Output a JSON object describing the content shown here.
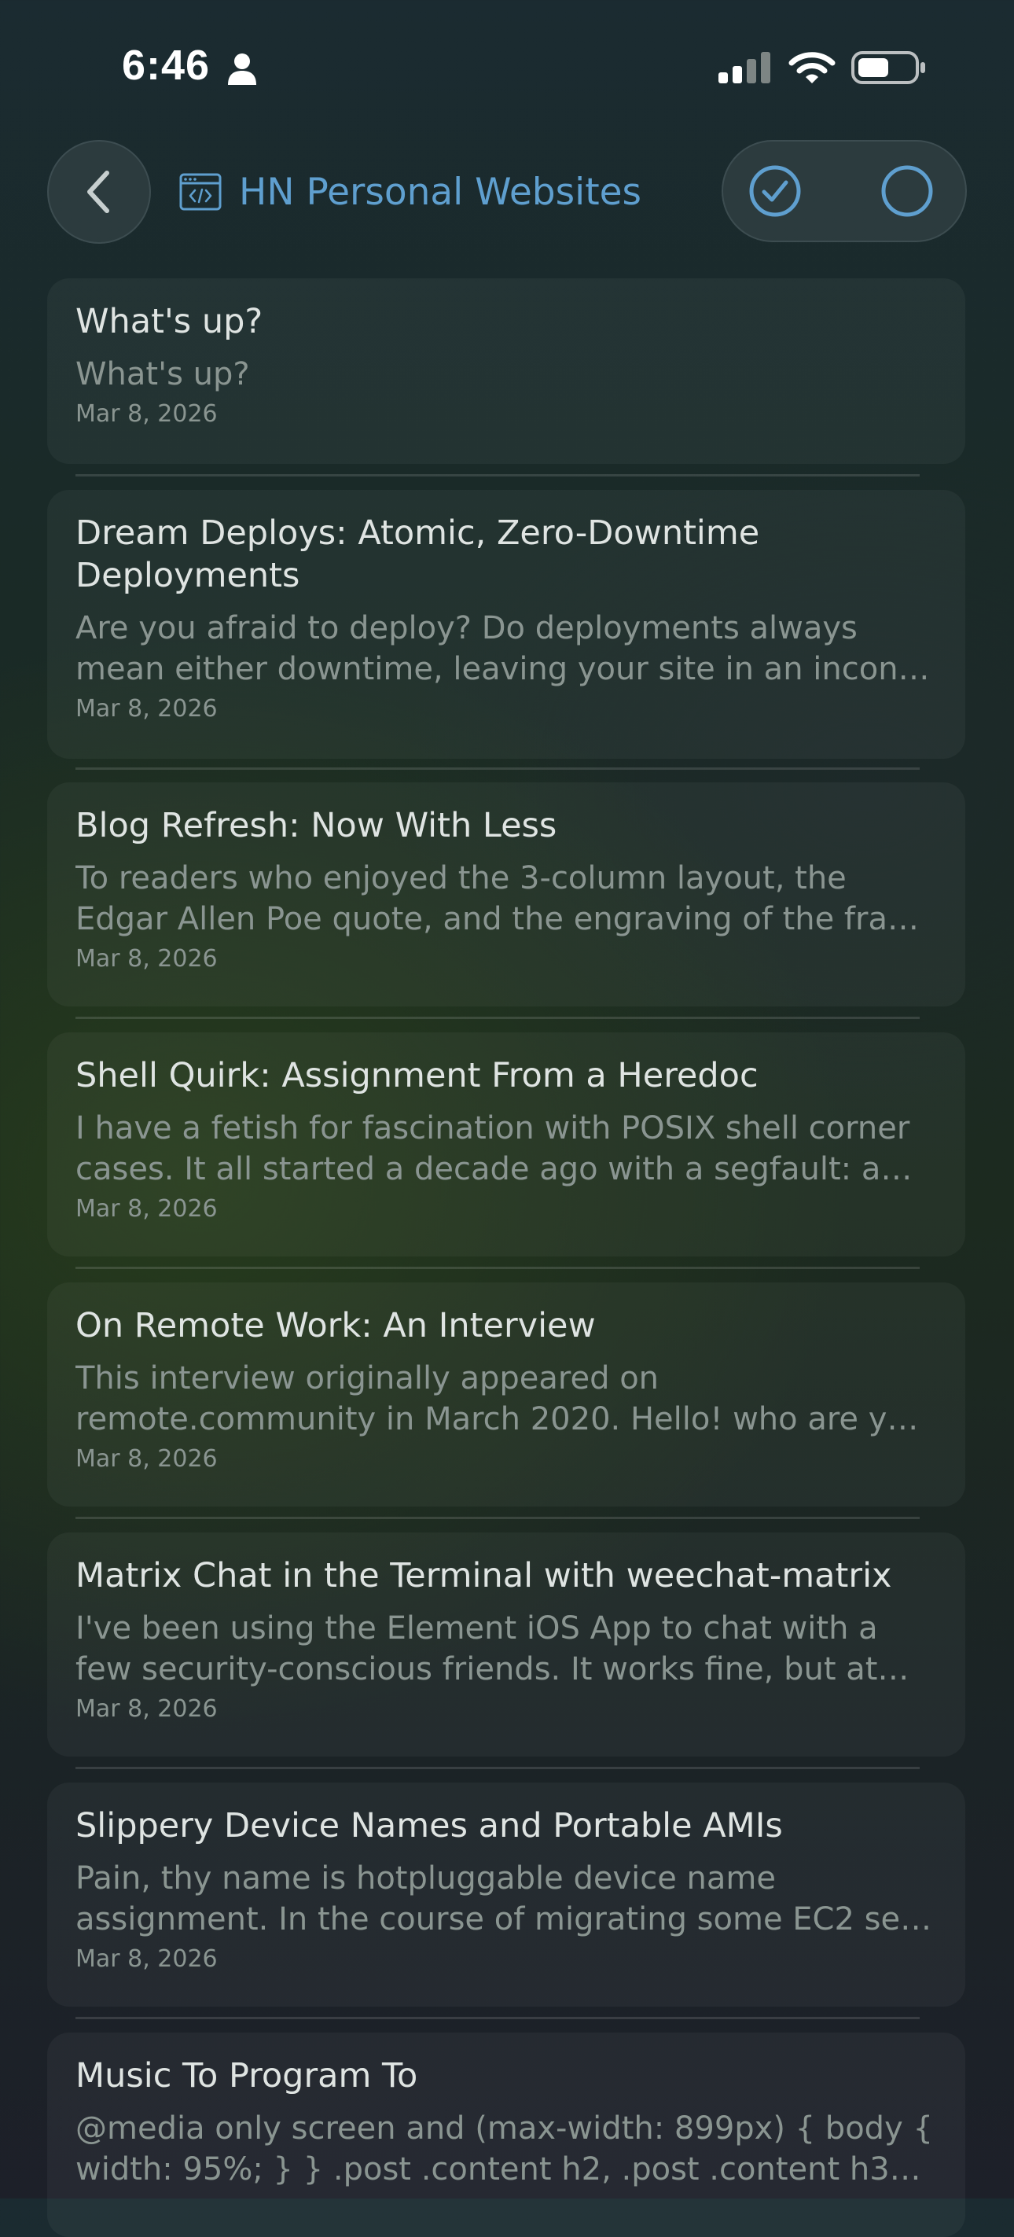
{
  "status_bar": {
    "time": "6:46"
  },
  "header": {
    "title": "HN Personal Websites",
    "back_icon": "chevron-left-icon",
    "title_icon": "code-window-icon",
    "read_icon": "checkmark-circle-icon",
    "unread_icon": "empty-circle-icon"
  },
  "colors": {
    "accent": "#5f9fcf",
    "title_text": "#dfe4e2",
    "secondary_text": "#8a9591"
  },
  "articles": [
    {
      "title": "What's up?",
      "summary": "What's up?",
      "date": "Mar 8, 2026"
    },
    {
      "title": "Dream Deploys: Atomic, Zero-Downtime Deployments",
      "summary": "Are you afraid to deploy? Do deployments always mean either downtime, leaving your site in an incon…",
      "date": "Mar 8, 2026"
    },
    {
      "title": "Blog Refresh: Now With Less",
      "summary": "To readers who enjoyed the 3-column layout, the Edgar Allen Poe quote, and the engraving of the fra…",
      "date": "Mar 8, 2026"
    },
    {
      "title": "Shell Quirk: Assignment From a Heredoc",
      "summary": "I have a fetish for fascination with POSIX shell corner cases. It all started a decade ago with a segfault: a c…",
      "date": "Mar 8, 2026"
    },
    {
      "title": "On Remote Work: An Interview",
      "summary": "This interview originally appeared on remote.community in March 2020. Hello! who are y…",
      "date": "Mar 8, 2026"
    },
    {
      "title": "Matrix Chat in the Terminal with weechat-matrix",
      "summary": "I've been using the Element iOS App to chat with a few security-conscious friends. It works fine, but at…",
      "date": "Mar 8, 2026"
    },
    {
      "title": "Slippery Device Names and Portable AMIs",
      "summary": "Pain, thy name is hotpluggable device name assignment. In the course of migrating some EC2 se…",
      "date": "Mar 8, 2026"
    },
    {
      "title": "Music To Program To",
      "summary": "@media only screen and (max-width: 899px) { body { width: 95%; } } .post .content h2, .post .content h3…",
      "date": ""
    }
  ]
}
